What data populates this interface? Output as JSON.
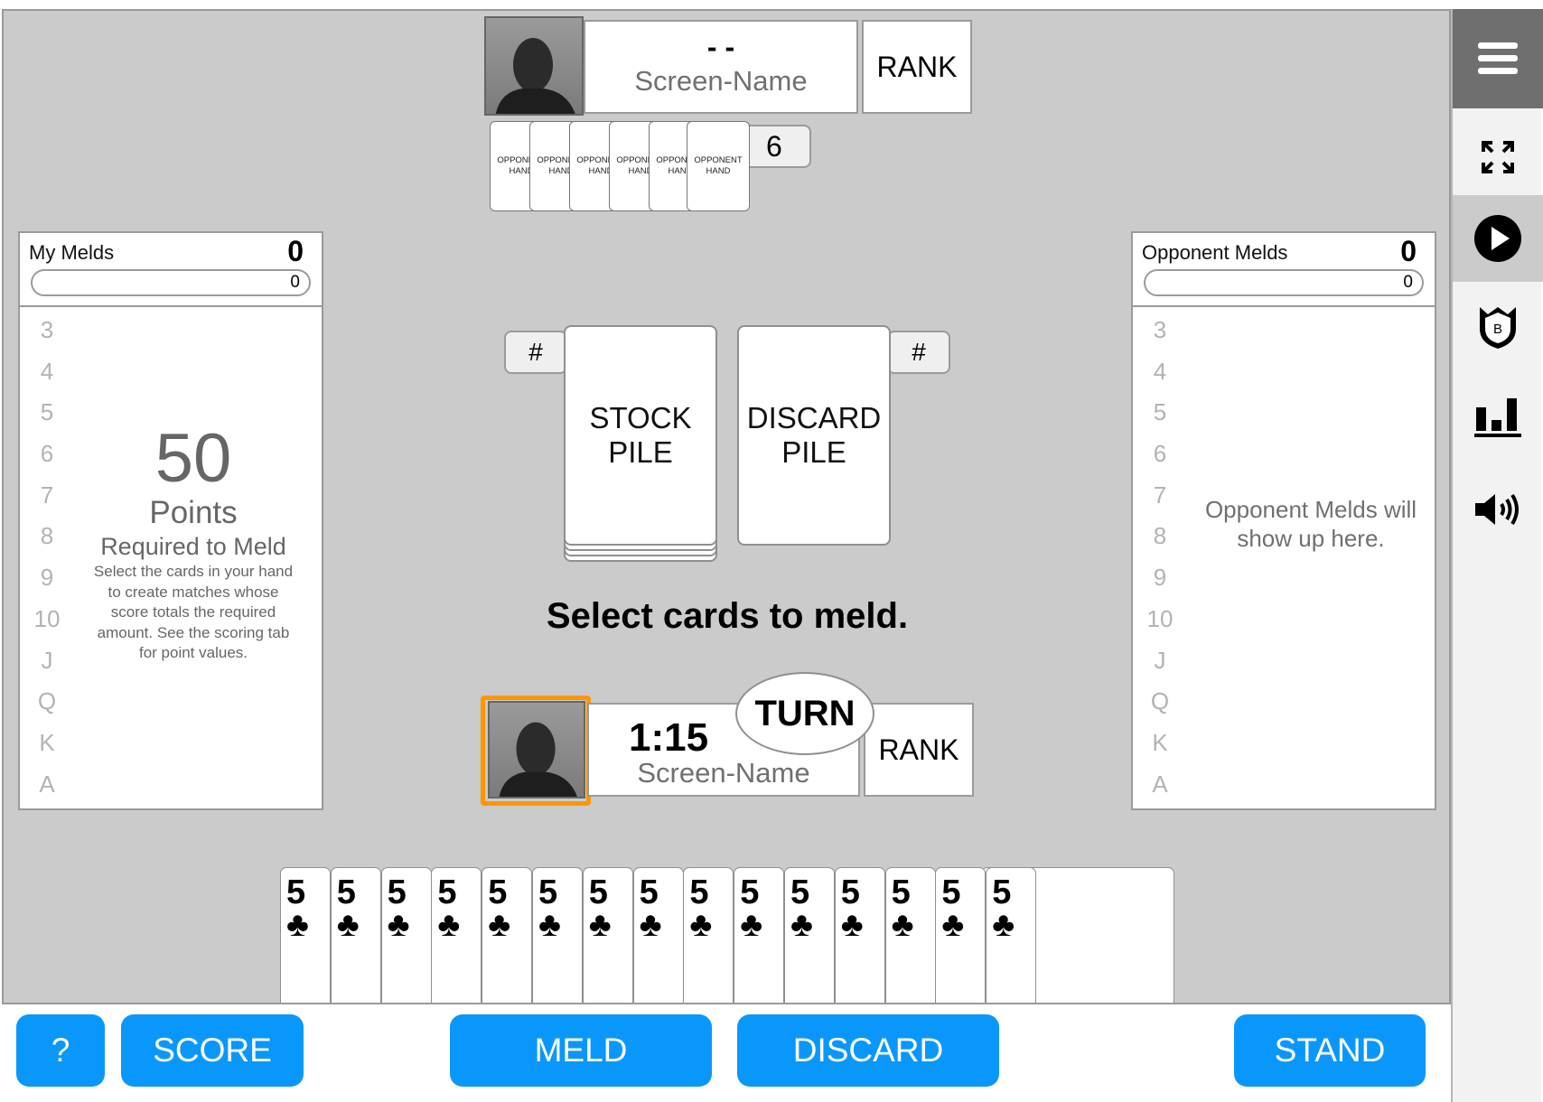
{
  "opponent": {
    "timer": "- -",
    "screen_name": "Screen-Name",
    "rank": "RANK",
    "hand_count": "6",
    "hand_card_label": "OPPONENT HAND",
    "hand_cards": [
      "OPPONENT HAND",
      "OPPONENT HAND",
      "OPPONENT HAND",
      "OPPONENT HAND",
      "OPPONENT HAND",
      "OPPONENT HAND"
    ]
  },
  "player": {
    "timer": "1:15",
    "screen_name": "Screen-Name",
    "rank": "RANK",
    "turn_label": "TURN",
    "active_color": "#ff9600"
  },
  "my_melds": {
    "title": "My Melds",
    "count": "0",
    "progress_value": "0",
    "progress_fraction": 0,
    "ranks": [
      "3",
      "4",
      "5",
      "6",
      "7",
      "8",
      "9",
      "10",
      "J",
      "Q",
      "K",
      "A"
    ],
    "points_required": "50",
    "points_label": "Points",
    "required_label": "Required to Meld",
    "instructions": "Select the cards in your hand to create matches whose score totals the required amount. See the scoring tab for point values."
  },
  "opponent_melds": {
    "title": "Opponent Melds",
    "count": "0",
    "progress_value": "0",
    "progress_fraction": 0,
    "ranks": [
      "3",
      "4",
      "5",
      "6",
      "7",
      "8",
      "9",
      "10",
      "J",
      "Q",
      "K",
      "A"
    ],
    "placeholder": "Opponent Melds will show up here."
  },
  "stock_pile": {
    "label": "STOCK PILE",
    "count": "#"
  },
  "discard_pile": {
    "label": "DISCARD PILE",
    "count": "#"
  },
  "prompt": "Select cards to meld.",
  "hand": [
    {
      "rank": "5",
      "suit": "♣"
    },
    {
      "rank": "5",
      "suit": "♣"
    },
    {
      "rank": "5",
      "suit": "♣"
    },
    {
      "rank": "5",
      "suit": "♣"
    },
    {
      "rank": "5",
      "suit": "♣"
    },
    {
      "rank": "5",
      "suit": "♣"
    },
    {
      "rank": "5",
      "suit": "♣"
    },
    {
      "rank": "5",
      "suit": "♣"
    },
    {
      "rank": "5",
      "suit": "♣"
    },
    {
      "rank": "5",
      "suit": "♣"
    },
    {
      "rank": "5",
      "suit": "♣"
    },
    {
      "rank": "5",
      "suit": "♣"
    },
    {
      "rank": "5",
      "suit": "♣"
    },
    {
      "rank": "5",
      "suit": "♣"
    },
    {
      "rank": "5",
      "suit": "♣"
    }
  ],
  "buttons": {
    "help": "?",
    "score": "SCORE",
    "meld": "MELD",
    "discard": "DISCARD",
    "stand": "STAND"
  },
  "sidebar": {
    "items": [
      "menu-icon",
      "fullscreen-icon",
      "play-icon",
      "badge-icon",
      "stats-icon",
      "volume-icon"
    ],
    "badge_letter": "B"
  },
  "colors": {
    "accent": "#0a97fc",
    "table": "#cbcbcb",
    "active_player": "#ff9600"
  }
}
